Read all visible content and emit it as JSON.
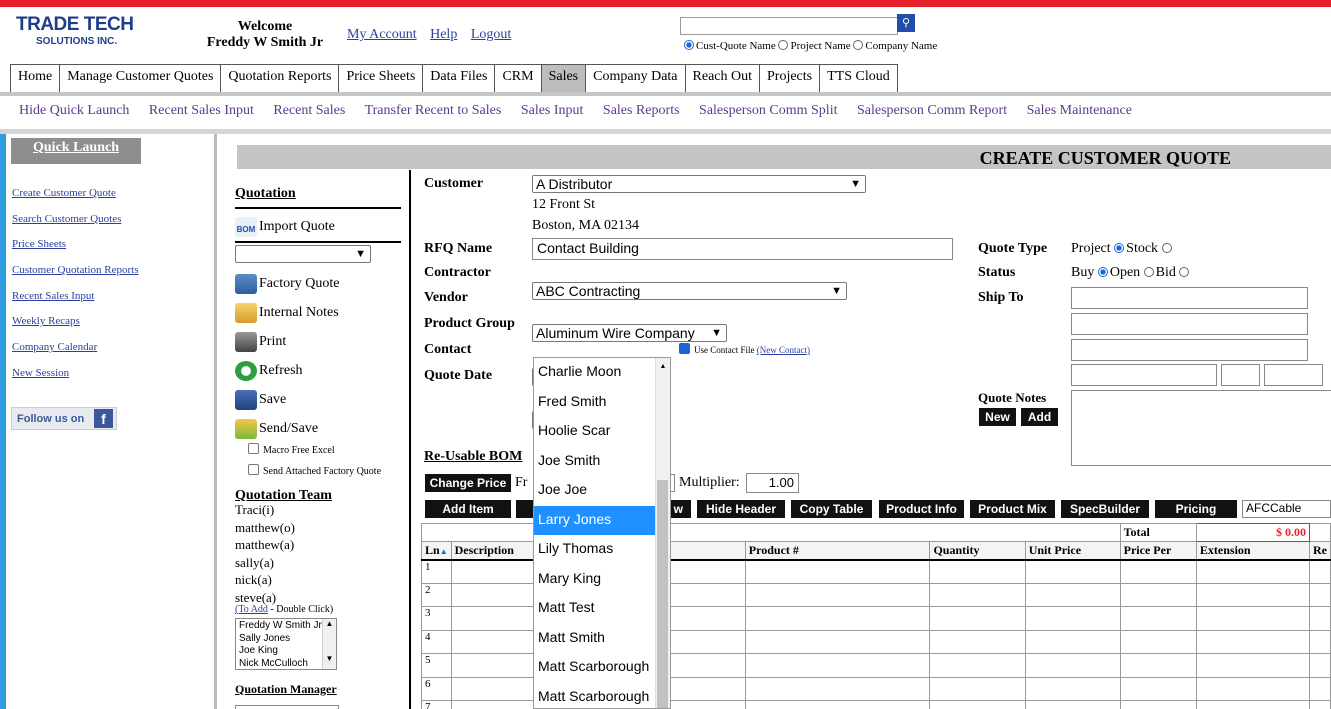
{
  "header": {
    "logo_line1": "TRADE TECH",
    "logo_line2": "SOLUTIONS INC.",
    "welcome_label": "Welcome",
    "user_name": "Freddy W Smith Jr",
    "links": [
      "My Account",
      "Help",
      "Logout"
    ],
    "search_placeholder": "",
    "search_options": [
      "Cust-Quote Name",
      "Project Name",
      "Company Name"
    ],
    "search_selected": "Cust-Quote Name"
  },
  "tabs": [
    {
      "label": "Home",
      "active": false
    },
    {
      "label": "Manage Customer Quotes",
      "active": false
    },
    {
      "label": "Quotation Reports",
      "active": false
    },
    {
      "label": "Price Sheets",
      "active": false
    },
    {
      "label": "Data Files",
      "active": false
    },
    {
      "label": "CRM",
      "active": false
    },
    {
      "label": "Sales",
      "active": true
    },
    {
      "label": "Company Data",
      "active": false
    },
    {
      "label": "Reach Out",
      "active": false
    },
    {
      "label": "Projects",
      "active": false
    },
    {
      "label": "TTS Cloud",
      "active": false
    }
  ],
  "subnav": [
    "Hide Quick Launch",
    "Recent Sales Input",
    "Recent Sales",
    "Transfer Recent to Sales",
    "Sales Input",
    "Sales Reports",
    "Salesperson Comm Split",
    "Salesperson Comm Report",
    "Sales Maintenance"
  ],
  "quick_launch": {
    "title": "Quick Launch",
    "items": [
      "Create Customer Quote",
      "Search Customer Quotes",
      "Price Sheets",
      "Customer Quotation Reports",
      "Recent Sales Input",
      "Weekly Recaps",
      "Company Calendar",
      "New Session"
    ],
    "follow": "Follow us on",
    "fb_glyph": "f"
  },
  "quotation": {
    "title": "Quotation",
    "import": "Import Quote",
    "import_icon_text": "BOM",
    "actions": [
      "Factory Quote",
      "Internal Notes",
      "Print",
      "Refresh",
      "Save",
      "Send/Save"
    ],
    "checkboxes": [
      "Macro Free Excel",
      "Send Attached Factory Quote"
    ],
    "team_title": "Quotation Team",
    "team": [
      "Traci(i)",
      "matthew(o)",
      "matthew(a)",
      "sally(a)",
      "nick(a)",
      "steve(a)"
    ],
    "to_add_link": "(To Add",
    "to_add_rest": " - Double Click)",
    "team_list": [
      "Freddy W Smith Jr",
      "Sally Jones",
      "Joe King",
      "Nick McCulloch"
    ],
    "manager_title": "Quotation Manager"
  },
  "form": {
    "page_title": "CREATE CUSTOMER QUOTE",
    "customer_label": "Customer",
    "customer_value": "A Distributor",
    "address1": "12 Front St",
    "address2": "Boston, MA 02134",
    "rfq_label": "RFQ Name",
    "rfq_value": "Contact Building",
    "contractor_label": "Contractor",
    "contractor_value": "ABC Contracting",
    "vendor_label": "Vendor",
    "vendor_value": "Aluminum Wire Company",
    "product_group_label": "Product Group",
    "contact_label": "Contact",
    "use_contact_file": "Use Contact File",
    "new_contact": "(New Contact)",
    "quote_date_label": "Quote Date",
    "reusable_bom_label": "Re-Usable BOM",
    "change_price": "Change Price",
    "from_partial": "Fr",
    "multiplier_label": "Multiplier:",
    "multiplier_value": "1.00",
    "quote_type_label": "Quote Type",
    "quote_type_options": [
      "Project",
      "Stock"
    ],
    "quote_type_selected": "Stock",
    "status_label": "Status",
    "status_options": [
      "Buy",
      "Open",
      "Bid"
    ],
    "status_selected": "Open",
    "ship_to_label": "Ship To",
    "quote_notes_label": "Quote Notes",
    "notes_new": "New",
    "notes_add": "Add"
  },
  "contact_dropdown": {
    "options": [
      "Charlie Moon",
      "Fred Smith",
      "Hoolie Scar",
      "Joe Smith",
      "Joe Joe",
      "Larry Jones",
      "Lily Thomas",
      "Mary King",
      "Matt Test",
      "Matt Smith",
      "Matt Scarborough",
      "Matt Scarborough"
    ],
    "highlighted": "Larry Jones"
  },
  "toolbar": {
    "add_item": "Add Item",
    "partial_w": "w",
    "buttons": [
      "Hide Header",
      "Copy Table",
      "Product Info",
      "Product Mix",
      "SpecBuilder",
      "Pricing"
    ],
    "pricing_value": "AFCCable"
  },
  "grid": {
    "total_label": "Total",
    "total_value": "$ 0.00",
    "columns": [
      "Ln",
      "Description",
      "",
      "Product #",
      "Quantity",
      "Unit Price",
      "Price Per",
      "Extension",
      "Re"
    ],
    "rows": [
      "1",
      "2",
      "3",
      "4",
      "5",
      "6",
      "7"
    ]
  },
  "colors": {
    "accent_red": "#e8202a",
    "link_blue": "#2a3f9e",
    "highlight": "#1e90ff",
    "strip_blue": "#2f9ce0"
  }
}
